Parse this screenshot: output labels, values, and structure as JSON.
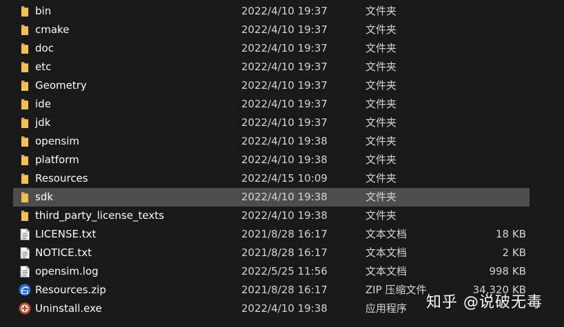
{
  "files": [
    {
      "name": "bin",
      "date": "2022/4/10 19:37",
      "type": "文件夹",
      "size": "",
      "icon": "folder-icon"
    },
    {
      "name": "cmake",
      "date": "2022/4/10 19:37",
      "type": "文件夹",
      "size": "",
      "icon": "folder-icon"
    },
    {
      "name": "doc",
      "date": "2022/4/10 19:37",
      "type": "文件夹",
      "size": "",
      "icon": "folder-icon"
    },
    {
      "name": "etc",
      "date": "2022/4/10 19:37",
      "type": "文件夹",
      "size": "",
      "icon": "folder-icon"
    },
    {
      "name": "Geometry",
      "date": "2022/4/10 19:37",
      "type": "文件夹",
      "size": "",
      "icon": "folder-icon"
    },
    {
      "name": "ide",
      "date": "2022/4/10 19:37",
      "type": "文件夹",
      "size": "",
      "icon": "folder-icon"
    },
    {
      "name": "jdk",
      "date": "2022/4/10 19:37",
      "type": "文件夹",
      "size": "",
      "icon": "folder-icon"
    },
    {
      "name": "opensim",
      "date": "2022/4/10 19:38",
      "type": "文件夹",
      "size": "",
      "icon": "folder-icon"
    },
    {
      "name": "platform",
      "date": "2022/4/10 19:38",
      "type": "文件夹",
      "size": "",
      "icon": "folder-icon"
    },
    {
      "name": "Resources",
      "date": "2022/4/15 10:09",
      "type": "文件夹",
      "size": "",
      "icon": "folder-icon"
    },
    {
      "name": "sdk",
      "date": "2022/4/10 19:38",
      "type": "文件夹",
      "size": "",
      "icon": "folder-icon",
      "selected": true
    },
    {
      "name": "third_party_license_texts",
      "date": "2022/4/10 19:38",
      "type": "文件夹",
      "size": "",
      "icon": "folder-icon"
    },
    {
      "name": "LICENSE.txt",
      "date": "2021/8/28 16:17",
      "type": "文本文档",
      "size": "18 KB",
      "icon": "text-file-icon"
    },
    {
      "name": "NOTICE.txt",
      "date": "2021/8/28 16:17",
      "type": "文本文档",
      "size": "2 KB",
      "icon": "text-file-icon"
    },
    {
      "name": "opensim.log",
      "date": "2022/5/25 11:56",
      "type": "文本文档",
      "size": "998 KB",
      "icon": "text-file-icon"
    },
    {
      "name": "Resources.zip",
      "date": "2021/8/28 16:17",
      "type": "ZIP 压缩文件",
      "size": "34,320 KB",
      "icon": "zip-file-icon"
    },
    {
      "name": "Uninstall.exe",
      "date": "2022/4/10 19:38",
      "type": "应用程序",
      "size": "",
      "icon": "uninstaller-icon"
    }
  ],
  "watermark": "知乎 @说破无毒",
  "colors": {
    "background": "#191919",
    "selection": "#4d4d4d",
    "folder": "#f2c14e"
  }
}
